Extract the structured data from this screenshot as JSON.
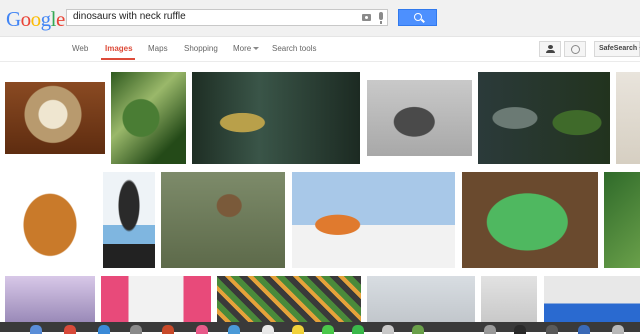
{
  "logo": {
    "letters": [
      "G",
      "o",
      "o",
      "g",
      "l",
      "e"
    ],
    "colors": [
      "#4285f4",
      "#ea4335",
      "#fbbc05",
      "#4285f4",
      "#34a853",
      "#ea4335"
    ]
  },
  "search": {
    "query": "dinosaurs with neck ruffle"
  },
  "icons": {
    "camera": "camera-icon",
    "mic": "microphone-icon",
    "search": "magnifier-icon",
    "account": "person-icon",
    "globe": "globe-icon"
  },
  "nav": {
    "web": "Web",
    "images": "Images",
    "maps": "Maps",
    "shopping": "Shopping",
    "more": "More",
    "search_tools": "Search tools",
    "safe_search": "SafeSearch"
  },
  "colors": {
    "accent": "#dd4b39",
    "button": "#4d90fe"
  }
}
